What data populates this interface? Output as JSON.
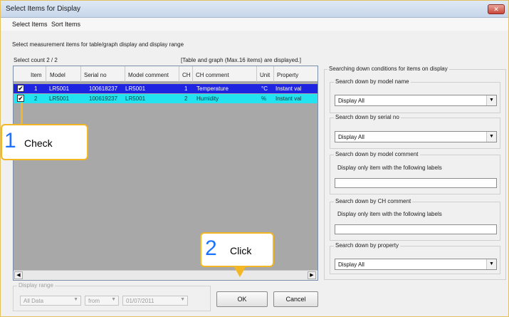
{
  "window": {
    "title": "Select Items for Display",
    "close": "✕"
  },
  "menu": [
    {
      "label": "Select Items"
    },
    {
      "label": "Sort Items"
    }
  ],
  "instruction": "Select measurement items for table/graph display and display range",
  "select_count": "Select count 2 / 2",
  "max_note": "[Table and graph (Max.16 items) are displayed.]",
  "grid": {
    "headers": [
      "Item",
      "Model",
      "Serial no",
      "Model comment",
      "CH",
      "CH comment",
      "Unit",
      "Property"
    ],
    "rows": [
      {
        "checked": "✔",
        "item": "1",
        "model": "LR5001",
        "serial": "100618237",
        "model_comment": "LR5001",
        "ch": "1",
        "ch_comment": "Temperature",
        "unit": "°C",
        "property": "Instant val"
      },
      {
        "checked": "✔",
        "item": "2",
        "model": "LR5001",
        "serial": "100619237",
        "model_comment": "LR5001",
        "ch": "2",
        "ch_comment": "Humidity",
        "unit": "%",
        "property": "Instant val"
      }
    ],
    "colors": {
      "row1": "#1f24e0",
      "row2": "#23e3f0"
    }
  },
  "display_range": {
    "legend": "Display range",
    "range_select": "All Data",
    "from_select": "from",
    "date_select": "01/07/2011"
  },
  "buttons": {
    "ok": "OK",
    "cancel": "Cancel"
  },
  "search": {
    "legend": "Searching down conditions for items on display",
    "model_name": {
      "legend": "Search down by model name",
      "value": "Display All"
    },
    "serial_no": {
      "legend": "Search down by serial no",
      "value": "Display All"
    },
    "model_comment": {
      "legend": "Search down by model comment",
      "note": "Display only item with the following labels",
      "value": ""
    },
    "ch_comment": {
      "legend": "Search down by CH comment",
      "note": "Display only item with the following labels",
      "value": ""
    },
    "property": {
      "legend": "Search down by property",
      "value": "Display All"
    }
  },
  "callouts": {
    "check": {
      "number": "1",
      "label": "Check"
    },
    "click": {
      "number": "2",
      "label": "Click"
    }
  },
  "icons": {
    "dropdown_arrow": "chevron-down-icon",
    "scroll_left": "arrow-left-icon",
    "scroll_right": "arrow-right-icon"
  }
}
